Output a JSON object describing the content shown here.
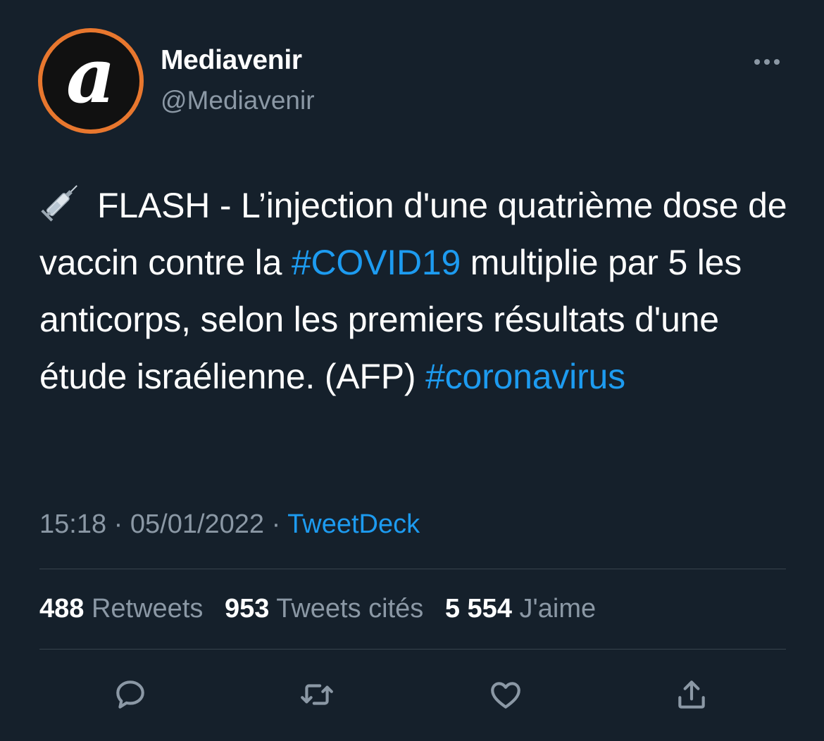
{
  "author": {
    "display_name": "Mediavenir",
    "handle": "@Mediavenir",
    "avatar_letter": "a",
    "avatar_ring_color": "#e8772e"
  },
  "tweet": {
    "emoji": "syringe-icon",
    "text_part1": "FLASH - L’injection d'une quatrième dose de vaccin contre la",
    "hashtag1": "#COVID19",
    "text_part2": "multiplie par 5 les anticorps, selon les premiers résultats d'une étude israélienne. (AFP)",
    "hashtag2": "#coronavirus"
  },
  "meta": {
    "time": "15:18",
    "separator": "·",
    "date": "05/01/2022",
    "source": "TweetDeck"
  },
  "stats": {
    "retweets_count": "488",
    "retweets_label": "Retweets",
    "quotes_count": "953",
    "quotes_label": "Tweets cités",
    "likes_count": "5 554",
    "likes_label": "J'aime"
  },
  "actions": [
    "reply-icon",
    "retweet-icon",
    "like-icon",
    "share-icon"
  ],
  "colors": {
    "background": "#15202b",
    "link": "#1d9bf0",
    "secondary_text": "#8b98a5",
    "divider": "#38444d"
  }
}
